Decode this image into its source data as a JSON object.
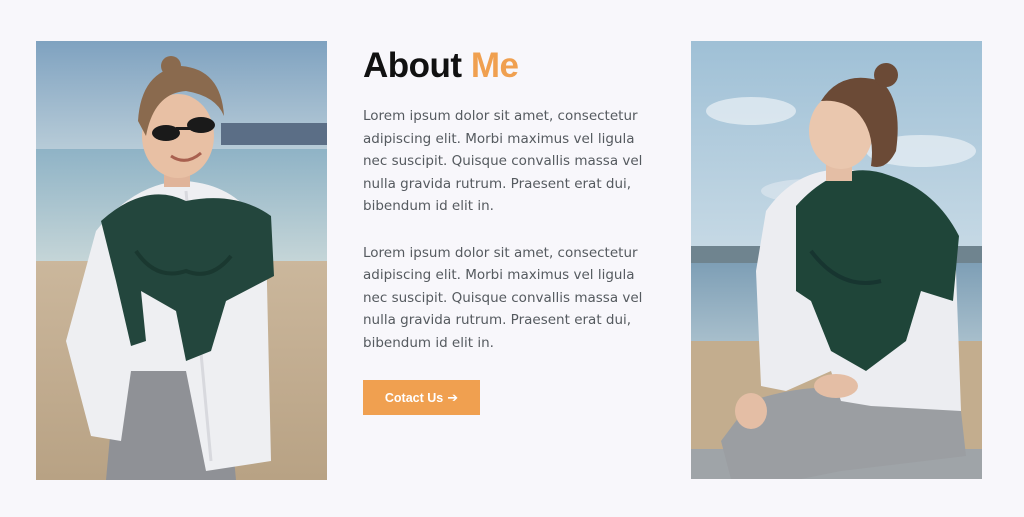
{
  "about": {
    "title_main": "About",
    "title_accent": "Me",
    "paragraphs": [
      "Lorem ipsum dolor sit amet, consectetur adipiscing elit. Morbi maximus vel ligula nec suscipit. Quisque convallis massa vel nulla gravida rutrum. Praesent erat dui, bibendum id elit in.",
      "Lorem ipsum dolor sit amet, consectetur adipiscing elit. Morbi maximus vel ligula nec suscipit. Quisque convallis massa vel nulla gravida rutrum. Praesent erat dui, bibendum id elit in."
    ],
    "button_label": "Cotact Us",
    "button_icon": "arrow-right-icon"
  },
  "colors": {
    "accent": "#f0a050",
    "heading": "#111111",
    "body_text": "#555a5f",
    "background": "#f8f7fb"
  }
}
